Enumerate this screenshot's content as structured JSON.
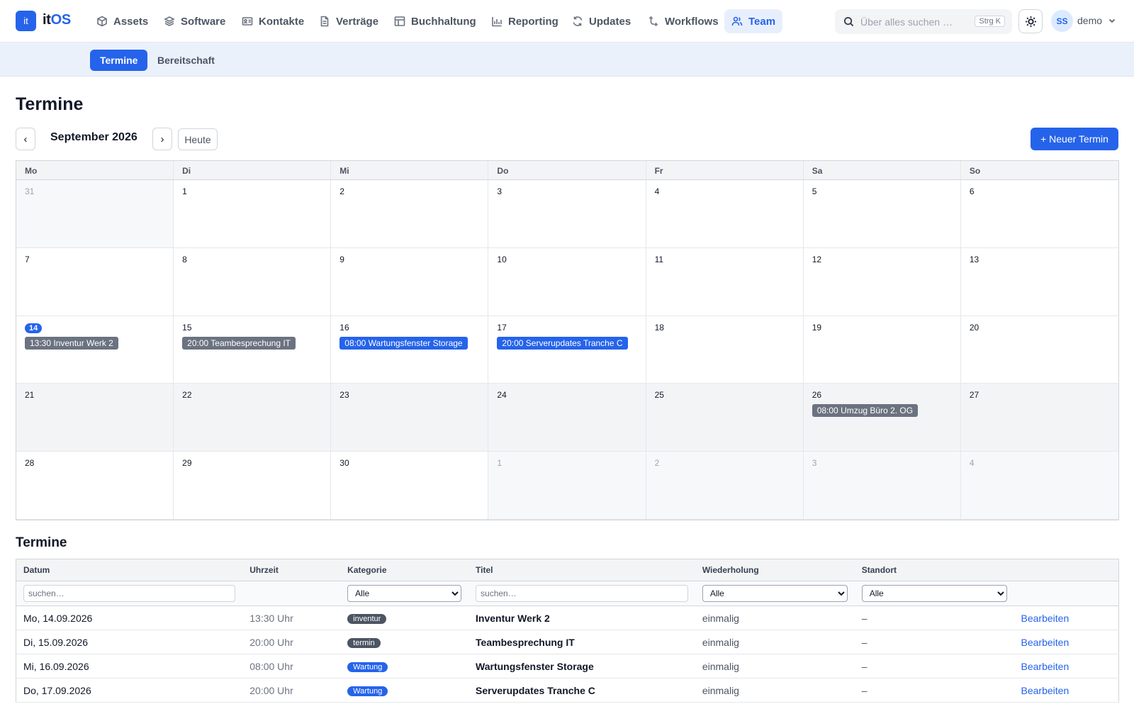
{
  "brand": {
    "logo_mark": "it",
    "name_part1": "it",
    "name_part2": "OS"
  },
  "nav": [
    {
      "label": "Assets",
      "icon": "cube-icon"
    },
    {
      "label": "Software",
      "icon": "layers-icon"
    },
    {
      "label": "Kontakte",
      "icon": "contact-card-icon"
    },
    {
      "label": "Verträge",
      "icon": "document-icon"
    },
    {
      "label": "Buchhaltung",
      "icon": "table-icon"
    },
    {
      "label": "Reporting",
      "icon": "bar-chart-icon"
    },
    {
      "label": "Updates",
      "icon": "refresh-icon"
    },
    {
      "label": "Workflows",
      "icon": "workflow-icon"
    },
    {
      "label": "Team",
      "icon": "users-icon",
      "active": true
    }
  ],
  "search": {
    "placeholder": "Über alles suchen …",
    "shortcut": "Strg K"
  },
  "user": {
    "initials": "SS",
    "name": "demo"
  },
  "subnav": {
    "tabs": [
      {
        "label": "Termine",
        "active": true
      },
      {
        "label": "Bereitschaft"
      }
    ]
  },
  "page": {
    "title": "Termine"
  },
  "calendar": {
    "month_label": "September 2026",
    "prev_label": "‹",
    "next_label": "›",
    "today_label": "Heute",
    "new_button": "+ Neuer Termin",
    "weekdays": [
      "Mo",
      "Di",
      "Mi",
      "Do",
      "Fr",
      "Sa",
      "So"
    ],
    "weeks": [
      [
        {
          "d": "31",
          "other": true
        },
        {
          "d": "1"
        },
        {
          "d": "2"
        },
        {
          "d": "3"
        },
        {
          "d": "4"
        },
        {
          "d": "5"
        },
        {
          "d": "6"
        }
      ],
      [
        {
          "d": "7"
        },
        {
          "d": "8"
        },
        {
          "d": "9"
        },
        {
          "d": "10"
        },
        {
          "d": "11"
        },
        {
          "d": "12"
        },
        {
          "d": "13"
        }
      ],
      [
        {
          "d": "14",
          "today": true,
          "events": [
            {
              "text": "13:30 Inventur Werk 2",
              "color": "gray"
            }
          ]
        },
        {
          "d": "15",
          "events": [
            {
              "text": "20:00 Teambesprechung IT",
              "color": "gray"
            }
          ]
        },
        {
          "d": "16",
          "events": [
            {
              "text": "08:00 Wartungsfenster Storage",
              "color": "blue"
            }
          ]
        },
        {
          "d": "17",
          "events": [
            {
              "text": "20:00 Serverupdates Tranche C",
              "color": "blue"
            }
          ]
        },
        {
          "d": "18"
        },
        {
          "d": "19"
        },
        {
          "d": "20"
        }
      ],
      [
        {
          "d": "21",
          "shade": true
        },
        {
          "d": "22",
          "shade": true
        },
        {
          "d": "23",
          "shade": true
        },
        {
          "d": "24",
          "shade": true
        },
        {
          "d": "25",
          "shade": true
        },
        {
          "d": "26",
          "shade": true,
          "events": [
            {
              "text": "08:00 Umzug Büro 2. OG",
              "color": "gray"
            }
          ]
        },
        {
          "d": "27",
          "shade": true
        }
      ],
      [
        {
          "d": "28"
        },
        {
          "d": "29"
        },
        {
          "d": "30"
        },
        {
          "d": "1",
          "other": true
        },
        {
          "d": "2",
          "other": true
        },
        {
          "d": "3",
          "other": true
        },
        {
          "d": "4",
          "other": true
        }
      ]
    ]
  },
  "list": {
    "title": "Termine",
    "columns": [
      "Datum",
      "Uhrzeit",
      "Kategorie",
      "Titel",
      "Wiederholung",
      "Standort",
      ""
    ],
    "filters": {
      "date_placeholder": "suchen…",
      "title_placeholder": "suchen…",
      "category": "Alle",
      "repeat": "Alle",
      "location": "Alle"
    },
    "rows": [
      {
        "date": "Mo, 14.09.2026",
        "time": "13:30 Uhr",
        "category": "inventur",
        "cat_color": "gray",
        "title": "Inventur Werk 2",
        "repeat": "einmalig",
        "location": "–",
        "action": "Bearbeiten"
      },
      {
        "date": "Di, 15.09.2026",
        "time": "20:00 Uhr",
        "category": "termin",
        "cat_color": "gray",
        "title": "Teambesprechung IT",
        "repeat": "einmalig",
        "location": "–",
        "action": "Bearbeiten"
      },
      {
        "date": "Mi, 16.09.2026",
        "time": "08:00 Uhr",
        "category": "Wartung",
        "cat_color": "blue",
        "title": "Wartungsfenster Storage",
        "repeat": "einmalig",
        "location": "–",
        "action": "Bearbeiten"
      },
      {
        "date": "Do, 17.09.2026",
        "time": "20:00 Uhr",
        "category": "Wartung",
        "cat_color": "blue",
        "title": "Serverupdates Tranche C",
        "repeat": "einmalig",
        "location": "–",
        "action": "Bearbeiten"
      }
    ]
  }
}
